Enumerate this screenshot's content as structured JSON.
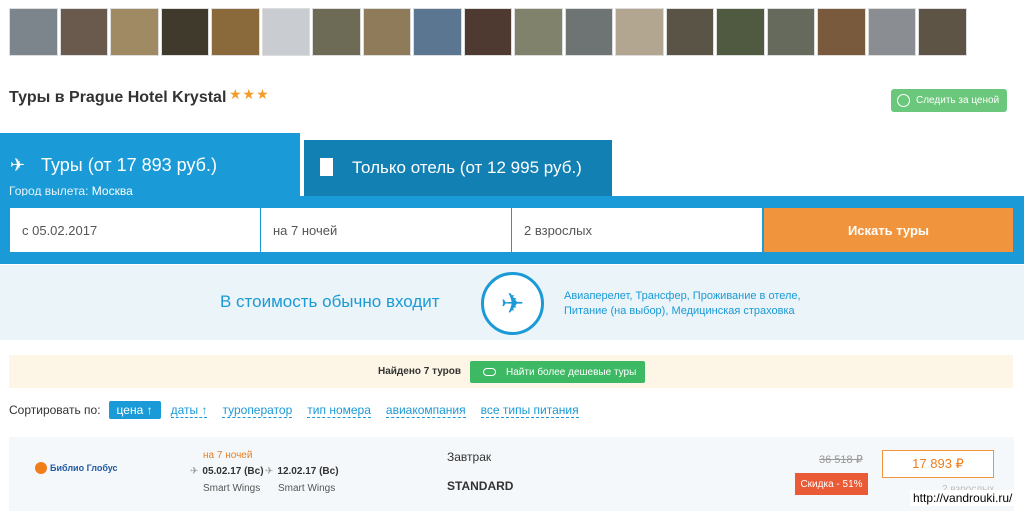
{
  "gallery": {
    "thumb_colors": [
      "#7d858c",
      "#6a5a4e",
      "#a08a63",
      "#3f3a2c",
      "#8a6a3a",
      "#c9ccd0",
      "#6d6a55",
      "#8f7a5a",
      "#5b7690",
      "#4e3a30",
      "#80826c",
      "#6e7473",
      "#b3a691",
      "#5a5446",
      "#4f5a40",
      "#666a5c",
      "#7a5a3c",
      "#8a8e93",
      "#5d5446"
    ]
  },
  "hotel": {
    "title": "Туры в Prague Hotel Krystal",
    "stars": "★★★",
    "track_price": "Следить за ценой"
  },
  "tabs": {
    "tours": {
      "icon": "plane-icon",
      "label": "Туры (от 17 893 руб.)",
      "city_label": "Город вылета:",
      "city": "Москва"
    },
    "hotel_only": {
      "icon": "building-icon",
      "label": "Только отель (от 12 995 руб.)"
    }
  },
  "search": {
    "date": "с 05.02.2017",
    "nights": "на 7 ночей",
    "guests": "2 взрослых",
    "button": "Искать туры"
  },
  "includes": {
    "heading": "В стоимость обычно входит",
    "line1": "Авиаперелет, Трансфер, Проживание в отеле,",
    "line2": "Питание (на выбор), Медицинская страховка"
  },
  "results": {
    "found": "Найдено 7 туров",
    "cheaper_button": "Найти более дешевые туры"
  },
  "sort": {
    "label": "Сортировать по:",
    "active": "цена ↑",
    "options": [
      "даты ↑",
      "туроператор",
      "тип номера",
      "авиакомпания",
      "все типы питания"
    ]
  },
  "tour": {
    "operator": "Библио Глобус",
    "nights": "на 7 ночей",
    "depart": "05.02.17 (Вс)",
    "return": "12.02.17 (Вс)",
    "airline_depart": "Smart Wings",
    "airline_return": "Smart Wings",
    "meal": "Завтрак",
    "room": "STANDARD",
    "old_price": "36 518 ₽",
    "discount": "Скидка - 51%",
    "price": "17 893 ₽",
    "guests": "2 взрослых"
  },
  "watermark": "http://vandrouki.ru/"
}
